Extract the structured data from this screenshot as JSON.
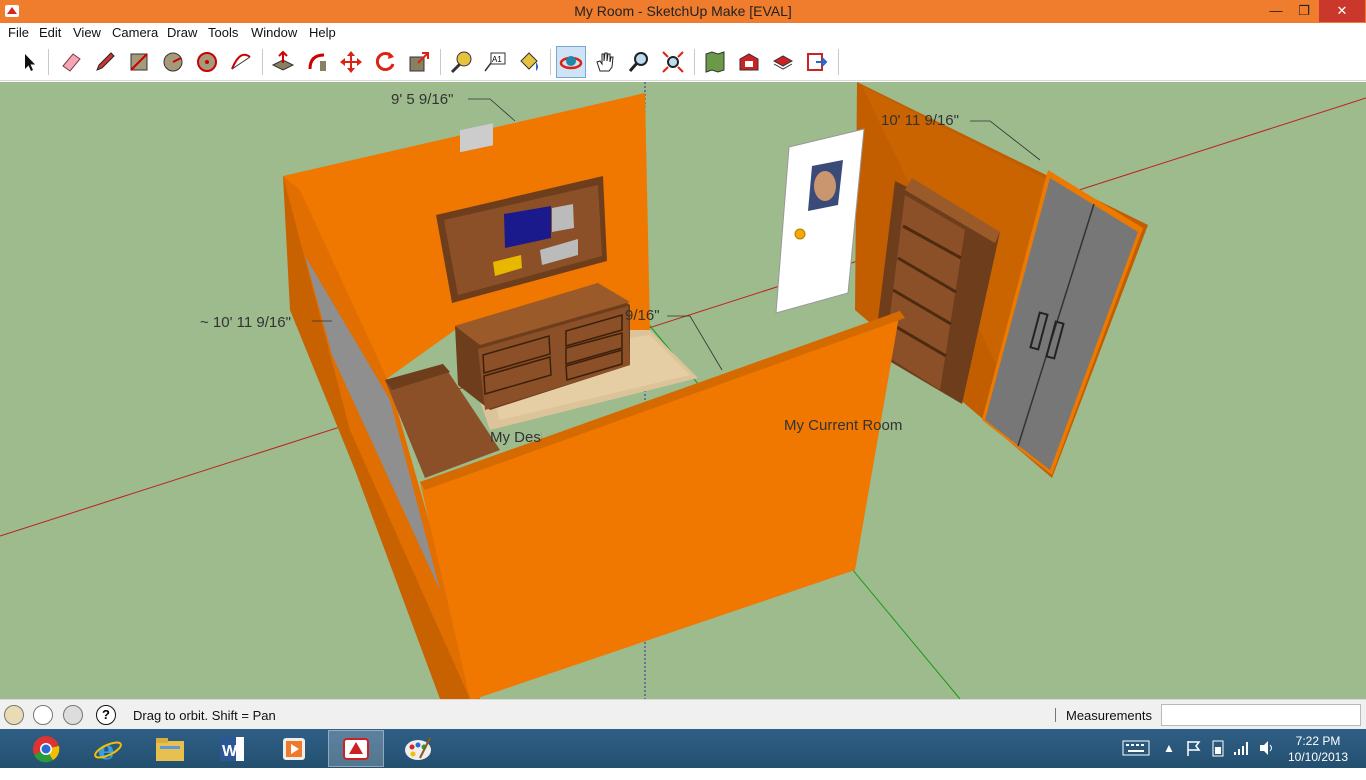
{
  "window": {
    "title": "My Room - SketchUp Make [EVAL]",
    "minimize": "—",
    "maximize": "❐",
    "close": "✕"
  },
  "menu": [
    "File",
    "Edit",
    "View",
    "Camera",
    "Draw",
    "Tools",
    "Window",
    "Help"
  ],
  "toolbar": {
    "tools": [
      "select",
      "eraser",
      "pencil-line",
      "rectangle",
      "circle",
      "polygon",
      "arc",
      "push-pull",
      "follow-me",
      "move",
      "rotate",
      "scale",
      "tape-measure",
      "text",
      "paint-bucket",
      "orbit",
      "pan",
      "zoom",
      "zoom-extents",
      "get-models",
      "share-model",
      "share-component",
      "send-to-layout"
    ],
    "active_tool": "orbit"
  },
  "scene": {
    "dimension_labels": [
      "9' 5 9/16\"",
      "10' 11 9/16\"",
      "~ 10' 11 9/16\"",
      "9/16\""
    ],
    "text_labels": [
      "My Current Room",
      "My Desk"
    ],
    "colors": {
      "ground": "#9dbb8d",
      "wall": "#f07800",
      "wall_dark": "#c86200",
      "wood": "#8c5028",
      "door": "#ffffff",
      "closet": "#7d7d7d"
    }
  },
  "status": {
    "message": "Drag to orbit.  Shift = Pan",
    "measurements_label": "Measurements",
    "measurements_value": ""
  },
  "taskbar": {
    "apps": [
      "chrome",
      "internet-explorer",
      "file-explorer",
      "word",
      "media-player",
      "sketchup",
      "paint"
    ],
    "active_app": "sketchup",
    "time": "7:22 PM",
    "date": "10/10/2013"
  }
}
